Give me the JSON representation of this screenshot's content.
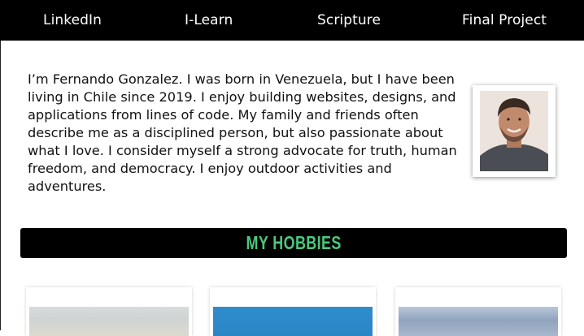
{
  "nav": {
    "items": [
      {
        "label": "LinkedIn"
      },
      {
        "label": "I-Learn"
      },
      {
        "label": "Scripture"
      },
      {
        "label": "Final Project"
      }
    ]
  },
  "about": {
    "bio": "I’m Fernando Gonzalez. I was born in Venezuela, but I have been living in Chile since 2019. I enjoy building websites, designs, and applications from lines of code. My family and friends often describe me as a disciplined person, but also passionate about what I love. I consider myself a strong advocate for truth, human freedom, and democracy. I enjoy outdoor activities and adventures."
  },
  "hobbies": {
    "title": "MY HOBBIES"
  },
  "colors": {
    "nav_bg": "#000000",
    "banner_bg": "#000000",
    "accent": "#4bc77e"
  }
}
